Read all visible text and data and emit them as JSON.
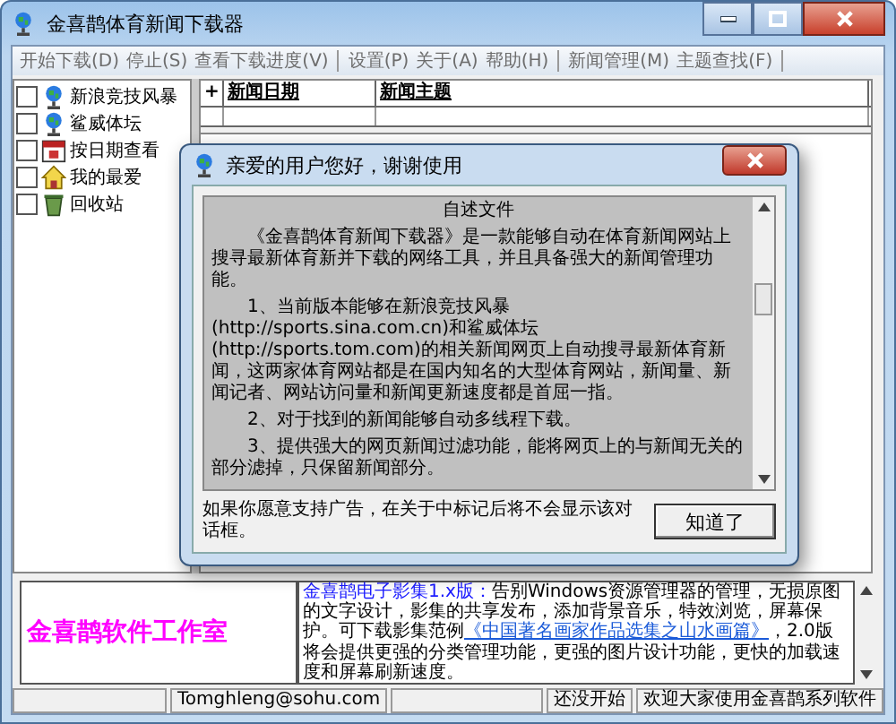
{
  "window": {
    "title": "金喜鹊体育新闻下载器"
  },
  "menu": [
    {
      "kind": "item",
      "label": "开始下载(D)"
    },
    {
      "kind": "item",
      "label": "停止(S)"
    },
    {
      "kind": "item",
      "label": "查看下载进度(V)"
    },
    {
      "kind": "separator"
    },
    {
      "kind": "item",
      "label": "设置(P)"
    },
    {
      "kind": "item",
      "label": "关于(A)"
    },
    {
      "kind": "item",
      "label": "帮助(H)"
    },
    {
      "kind": "separator"
    },
    {
      "kind": "item",
      "label": "新闻管理(M)"
    },
    {
      "kind": "item",
      "label": "主题查找(F)"
    },
    {
      "kind": "separator"
    }
  ],
  "tree": [
    {
      "label": "新浪竞技风暴",
      "checked": false
    },
    {
      "label": "鲨威体坛",
      "checked": false
    },
    {
      "label": "按日期查看",
      "checked": false
    },
    {
      "label": "我的最爱",
      "checked": false
    },
    {
      "label": "回收站",
      "checked": false
    }
  ],
  "table": {
    "corner": "+",
    "columns": [
      "新闻日期",
      "新闻主题"
    ]
  },
  "dialog": {
    "title": "亲爱的用户您好，谢谢使用",
    "heading": "自述文件",
    "paragraphs": [
      "《金喜鹊体育新闻下载器》是一款能够自动在体育新闻网站上搜寻最新体育新并下载的网络工具，并且具备强大的新闻管理功能。",
      "1、当前版本能够在新浪竞技风暴(http://sports.sina.com.cn)和鲨威体坛(http://sports.tom.com)的相关新闻网页上自动搜寻最新体育新闻，这两家体育网站都是在国内知名的大型体育网站，新闻量、新闻记者、网站访问量和新闻更新速度都是首屈一指。",
      "2、对于找到的新闻能够自动多线程下载。",
      "3、提供强大的网页新闻过滤功能，能将网页上的与新闻无关的部分滤掉，只保留新闻部分。"
    ],
    "note": "如果你愿意支持广告，在关于中标记后将不会显示该对话框。",
    "button": "知道了"
  },
  "ad": {
    "brand": "金喜鹊软件工作室",
    "lead": "金喜鹊电子影集1.x版：",
    "text1": "告别Windows资源管理器的管理，无损原图的文字设计，影集的共享发布，添加背景音乐，特效浏览，屏幕保护。可下载影集范例",
    "link": "《中国著名画家作品选集之山水画篇》",
    "text2": "，2.0版将会提供更强的分类管理功能，更强的图片设计功能，更快的加载速度和屏幕刷新速度。"
  },
  "status_bar": {
    "email": "Tomghleng@sohu.com",
    "state": "还没开始",
    "message": "欢迎大家使用金喜鹊系列软件"
  }
}
